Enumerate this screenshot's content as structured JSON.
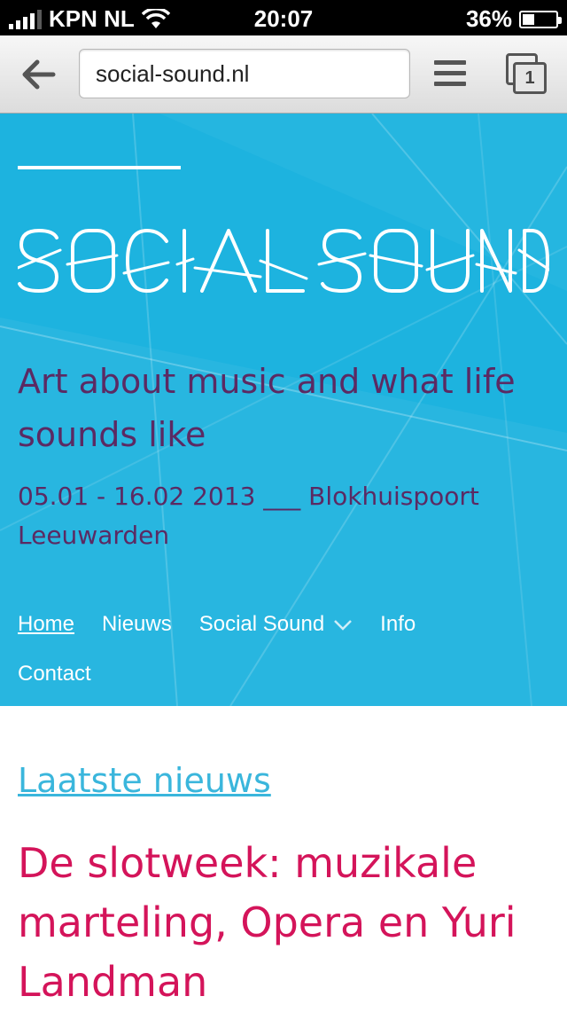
{
  "status_bar": {
    "carrier": "KPN NL",
    "time": "20:07",
    "battery": "36%",
    "battery_level": 0.36
  },
  "browser": {
    "url": "social-sound.nl"
  },
  "hero": {
    "logo_text": "SOCIAL SOUND",
    "tagline": "Art about music and what life sounds like",
    "dates": "05.01 - 16.02 2013 ___ Blokhuispoort Leeuwarden",
    "bg_color": "#1db3df",
    "text_color": "#5b2a63"
  },
  "nav": {
    "items": [
      {
        "label": "Home"
      },
      {
        "label": "Nieuws"
      },
      {
        "label": "Social Sound"
      },
      {
        "label": "Info"
      },
      {
        "label": "Contact"
      }
    ]
  },
  "main": {
    "section_title": "Laatste nieuws",
    "article_title": "De slotweek: muzikale marteling, Opera en Yuri Landman",
    "link_color": "#3ab6dc",
    "title_color": "#d4145a"
  },
  "icons": {
    "back": "back-arrow-icon",
    "menu": "menu-icon",
    "tabs": "tabs-icon",
    "wifi": "wifi-icon",
    "signal": "signal-icon",
    "battery": "battery-icon",
    "chevron": "chevron-down-icon"
  }
}
